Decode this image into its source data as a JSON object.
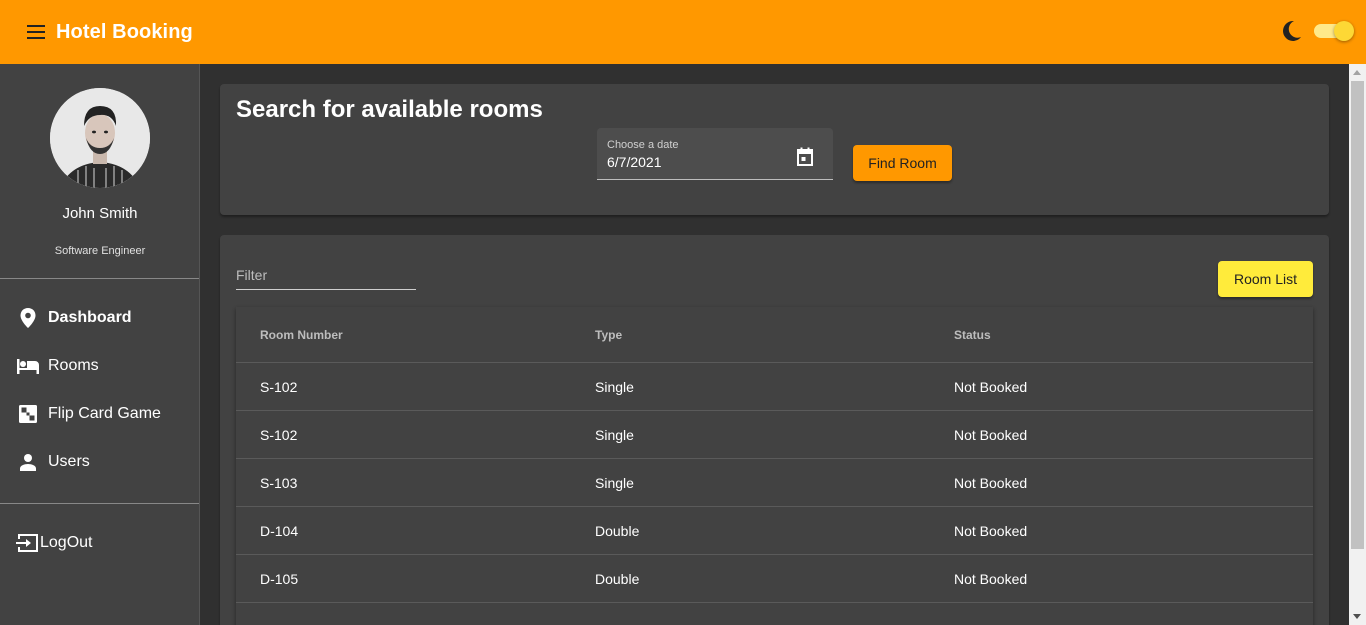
{
  "app": {
    "title": "Hotel Booking"
  },
  "profile": {
    "name": "John Smith",
    "role": "Software Engineer"
  },
  "nav": {
    "items": [
      {
        "label": "Dashboard",
        "icon": "location-pin-icon",
        "active": true
      },
      {
        "label": "Rooms",
        "icon": "bed-icon"
      },
      {
        "label": "Flip Card Game",
        "icon": "game-board-icon"
      },
      {
        "label": "Users",
        "icon": "person-icon"
      }
    ],
    "logout": {
      "label": "LogOut",
      "icon": "logout-icon"
    }
  },
  "search": {
    "title": "Search for available rooms",
    "date_label": "Choose a date",
    "date_value": "6/7/2021",
    "find_button": "Find Room"
  },
  "rooms": {
    "filter_placeholder": "Filter",
    "list_button": "Room List",
    "columns": [
      "Room Number",
      "Type",
      "Status"
    ],
    "rows": [
      [
        "S-102",
        "Single",
        "Not Booked"
      ],
      [
        "S-102",
        "Single",
        "Not Booked"
      ],
      [
        "S-103",
        "Single",
        "Not Booked"
      ],
      [
        "D-104",
        "Double",
        "Not Booked"
      ],
      [
        "D-105",
        "Double",
        "Not Booked"
      ]
    ]
  },
  "colors": {
    "primary": "#ff9800",
    "accent": "#ffeb3b",
    "background": "#303030",
    "surface": "#424242"
  }
}
